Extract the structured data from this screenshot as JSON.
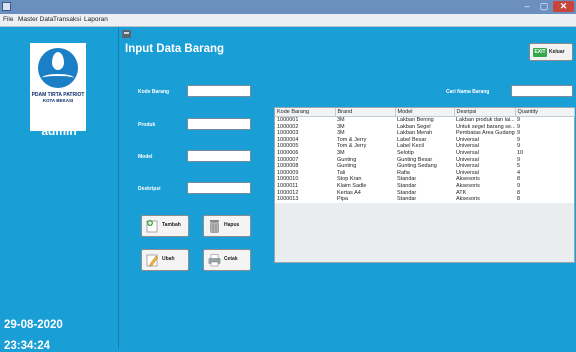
{
  "menubar": {
    "items": [
      "File",
      "Master Data",
      "Transaksi",
      "Laporan"
    ]
  },
  "window_controls": {
    "minimize": "–",
    "maximize": "▢",
    "close": "✕"
  },
  "sidebar": {
    "logo_line1": "PDAM TIRTA PATRIOT",
    "logo_line2": "KOTA BEKASI",
    "username": "admin",
    "date": "29-08-2020",
    "time": "23:34:24"
  },
  "main": {
    "title": "Input Data Barang",
    "exit_icon_text": "EXIT",
    "exit_label": "Keluar",
    "search_label": "Cari Nama Barang",
    "search_value": "",
    "fields": [
      {
        "label": "Kode Barang",
        "value": ""
      },
      {
        "label": "Produk",
        "value": ""
      },
      {
        "label": "Model",
        "value": ""
      },
      {
        "label": "Deskripsi",
        "value": ""
      }
    ],
    "buttons": {
      "tambah": "Tambah",
      "hapus": "Hapus",
      "ubah": "Ubah",
      "cetak": "Cetak"
    }
  },
  "table": {
    "columns": [
      "Kode Barang",
      "Brand",
      "Model",
      "Desripsi",
      "Quantity"
    ],
    "rows": [
      [
        "1000001",
        "3M",
        "Lakban Bening",
        "Lakban produk dan lai...",
        "9"
      ],
      [
        "1000002",
        "3M",
        "Lakban Segel",
        "Untuk segel barang se...",
        "9"
      ],
      [
        "1000003",
        "3M",
        "Lakban Merah",
        "Pembatas Area Gudang",
        "9"
      ],
      [
        "1000004",
        "Tom & Jerry",
        "Label Besar",
        "Universal",
        "9"
      ],
      [
        "1000005",
        "Tom & Jerry",
        "Label Kecil",
        "Universal",
        "9"
      ],
      [
        "1000006",
        "3M",
        "Selotip",
        "Universal",
        "10"
      ],
      [
        "1000007",
        "Gunting",
        "Gunting Besar",
        "Universal",
        "9"
      ],
      [
        "1000008",
        "Gunting",
        "Gunting Sedang",
        "Universal",
        "5"
      ],
      [
        "1000009",
        "Tali",
        "Rafia",
        "Universal",
        "4"
      ],
      [
        "1000010",
        "Stop Kran",
        "Standar",
        "Aksesoris",
        "8"
      ],
      [
        "1000011",
        "Klaim Sadle",
        "Standar",
        "Aksesoris",
        "9"
      ],
      [
        "1000012",
        "Kertas A4",
        "Standar",
        "ATK",
        "8"
      ],
      [
        "1000013",
        "Pipa",
        "Standar",
        "Aksesoris",
        "8"
      ]
    ]
  }
}
